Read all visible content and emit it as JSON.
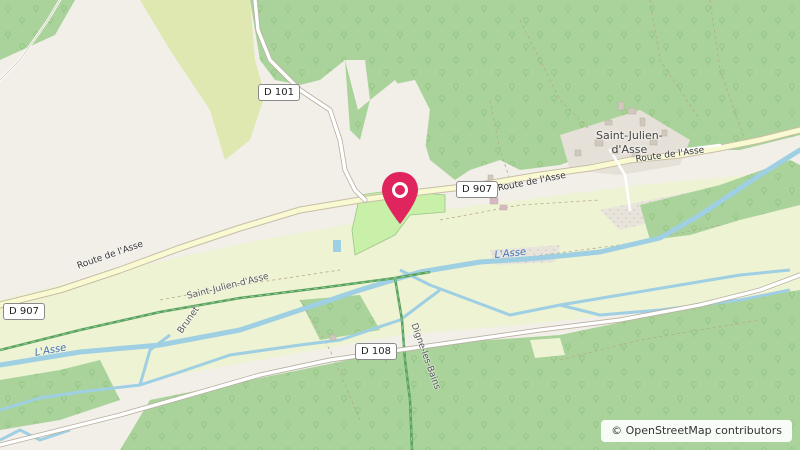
{
  "roads": {
    "d101": "D 101",
    "d907_center": "D 907",
    "d907_left": "D 907",
    "d108": "D 108"
  },
  "road_names": {
    "route_asse_left": "Route de l'Asse",
    "route_asse_mid": "Route de l'Asse",
    "route_asse_right": "Route de l'Asse"
  },
  "places": {
    "village": "Saint-Julien-\nd'Asse"
  },
  "waterways": {
    "asse_center": "L'Asse",
    "asse_left": "L'Asse"
  },
  "tracks": {
    "brunet": "Brunet",
    "saint_julien_track": "Saint-Julien-d'Asse",
    "digne": "Digne-les-Bains"
  },
  "attribution": {
    "symbol": "©",
    "text": "OpenStreetMap contributors"
  },
  "marker": {
    "color": "#e0245e",
    "icon": "map-pin-icon"
  },
  "colors": {
    "background": "#f2efe9",
    "forest": "#a9d39b",
    "meadow": "#e8f0c8",
    "water": "#9fcfe3",
    "park": "#c8f0a8",
    "grassland": "#dde9b1",
    "railway": "#5aa060"
  }
}
